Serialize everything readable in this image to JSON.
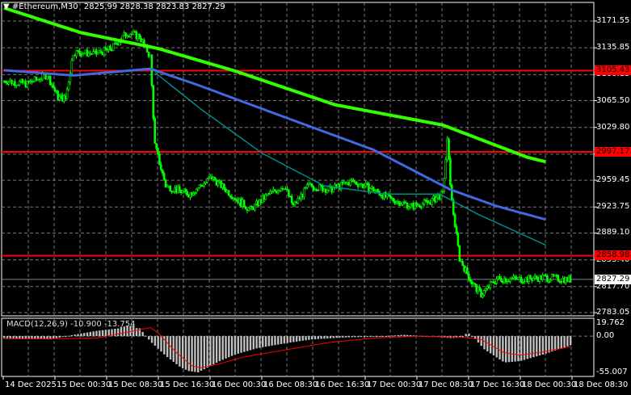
{
  "header": {
    "symbol": "#Ethereum,M30",
    "ohlc": "2825.99 2828.38 2823.83 2827.29",
    "menu_icon": "triangle-down-icon"
  },
  "colors": {
    "up": "#00ff00",
    "down": "#00ff00",
    "ma_slow": "#32ff00",
    "ma_mid": "#4169e1",
    "ma_fast": "#008b8b",
    "level": "#ff0000",
    "bid": "#778899",
    "hist": "#c0c0c0",
    "signal": "#ff0000"
  },
  "price_axis": {
    "ticks": [
      "3171.55",
      "3135.85",
      "3100.15",
      "3065.50",
      "3029.80",
      "2994.10",
      "2959.45",
      "2923.75",
      "2889.10",
      "2853.40",
      "2817.70",
      "2783.05"
    ],
    "range": [
      2783.05,
      3171.55
    ]
  },
  "levels": [
    "3105.43",
    "2997.17",
    "2858.98"
  ],
  "current_price": "2827.29",
  "macd": {
    "label": "MACD(12,26,9) -10.900 -13.754",
    "ticks": [
      "19.762",
      "0.00",
      "-55.007"
    ],
    "range": [
      -55.007,
      19.762
    ],
    "hist": [
      [
        0,
        -3
      ],
      [
        30,
        -5
      ],
      [
        45,
        2
      ],
      [
        60,
        8
      ],
      [
        75,
        12
      ],
      [
        56,
        10
      ],
      [
        85,
        16
      ],
      [
        60,
        14
      ],
      [
        88,
        12
      ],
      [
        95,
        -8
      ],
      [
        105,
        -30
      ],
      [
        115,
        -48
      ],
      [
        120,
        -53
      ],
      [
        126,
        -55
      ],
      [
        140,
        -38
      ],
      [
        150,
        -28
      ],
      [
        165,
        -18
      ],
      [
        185,
        -10
      ],
      [
        200,
        -5
      ],
      [
        220,
        -2
      ],
      [
        240,
        -1
      ],
      [
        260,
        2
      ],
      [
        280,
        -1
      ],
      [
        290,
        -3
      ],
      [
        298,
        -2
      ],
      [
        301,
        6
      ],
      [
        305,
        -2
      ],
      [
        312,
        -20
      ],
      [
        325,
        -40
      ],
      [
        335,
        -38
      ],
      [
        350,
        -28
      ],
      [
        368,
        -14
      ]
    ],
    "signal": [
      [
        0,
        -4
      ],
      [
        30,
        -4
      ],
      [
        60,
        -3
      ],
      [
        80,
        6
      ],
      [
        95,
        13
      ],
      [
        100,
        5
      ],
      [
        112,
        -25
      ],
      [
        122,
        -45
      ],
      [
        128,
        -48
      ],
      [
        140,
        -42
      ],
      [
        155,
        -32
      ],
      [
        180,
        -22
      ],
      [
        210,
        -10
      ],
      [
        240,
        -3
      ],
      [
        270,
        0
      ],
      [
        300,
        -2
      ],
      [
        310,
        -5
      ],
      [
        325,
        -25
      ],
      [
        335,
        -29
      ],
      [
        350,
        -24
      ],
      [
        368,
        -16
      ]
    ]
  },
  "time_axis": [
    "14 Dec 2025",
    "15 Dec 00:30",
    "15 Dec 08:30",
    "15 Dec 16:30",
    "16 Dec 00:30",
    "16 Dec 08:30",
    "16 Dec 16:30",
    "17 Dec 00:30",
    "17 Dec 08:30",
    "17 Dec 16:30",
    "18 Dec 00:30",
    "18 Dec 08:30"
  ],
  "chart_data": {
    "type": "candlestick",
    "bars": 369,
    "close_anchors": [
      [
        0,
        3092
      ],
      [
        15,
        3088
      ],
      [
        28,
        3100
      ],
      [
        35,
        3070
      ],
      [
        40,
        3068
      ],
      [
        45,
        3130
      ],
      [
        60,
        3128
      ],
      [
        70,
        3135
      ],
      [
        80,
        3156
      ],
      [
        88,
        3151
      ],
      [
        95,
        3124
      ],
      [
        98,
        3006
      ],
      [
        105,
        2952
      ],
      [
        120,
        2941
      ],
      [
        135,
        2963
      ],
      [
        150,
        2936
      ],
      [
        160,
        2920
      ],
      [
        172,
        2941
      ],
      [
        182,
        2952
      ],
      [
        188,
        2925
      ],
      [
        198,
        2952
      ],
      [
        212,
        2947
      ],
      [
        226,
        2958
      ],
      [
        240,
        2947
      ],
      [
        250,
        2935
      ],
      [
        265,
        2925
      ],
      [
        276,
        2930
      ],
      [
        285,
        2941
      ],
      [
        288,
        3011
      ],
      [
        291,
        2930
      ],
      [
        296,
        2855
      ],
      [
        304,
        2823
      ],
      [
        310,
        2807
      ],
      [
        320,
        2828
      ],
      [
        340,
        2828
      ],
      [
        350,
        2830
      ],
      [
        368,
        2827
      ]
    ],
    "ma_slow": [
      [
        0,
        3189
      ],
      [
        50,
        3156
      ],
      [
        100,
        3135
      ],
      [
        150,
        3105
      ],
      [
        215,
        3060
      ],
      [
        285,
        3033
      ],
      [
        340,
        2990
      ],
      [
        352,
        2984
      ]
    ],
    "ma_mid": [
      [
        0,
        3106
      ],
      [
        45,
        3099
      ],
      [
        95,
        3108
      ],
      [
        125,
        3087
      ],
      [
        175,
        3049
      ],
      [
        240,
        3000
      ],
      [
        290,
        2947
      ],
      [
        320,
        2925
      ],
      [
        352,
        2907
      ]
    ],
    "ma_fast": [
      [
        98,
        3103
      ],
      [
        128,
        3054
      ],
      [
        168,
        2995
      ],
      [
        208,
        2952
      ],
      [
        248,
        2941
      ],
      [
        283,
        2941
      ],
      [
        308,
        2914
      ],
      [
        352,
        2873
      ]
    ]
  }
}
